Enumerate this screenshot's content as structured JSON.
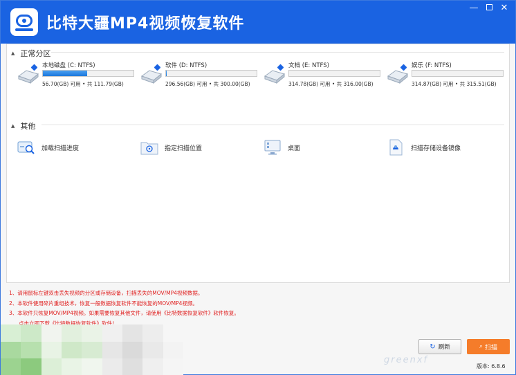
{
  "window": {
    "title": "比特大疆MP4视频恢复软件",
    "minimize": "—",
    "close": "✕"
  },
  "sections": {
    "normal_label": "正常分区",
    "other_label": "其他"
  },
  "drives": [
    {
      "name": "本地磁盘 (C: NTFS)",
      "info": "56.70(GB) 可用 • 共 111.79(GB)",
      "used_fraction": 0.49
    },
    {
      "name": "软件 (D: NTFS)",
      "info": "296.56(GB) 可用 • 共 300.00(GB)",
      "used_fraction": 0.01
    },
    {
      "name": "文档 (E: NTFS)",
      "info": "314.78(GB) 可用 • 共 316.00(GB)",
      "used_fraction": 0.0
    },
    {
      "name": "娱乐 (F: NTFS)",
      "info": "314.87(GB) 可用 • 共 315.51(GB)",
      "used_fraction": 0.0
    }
  ],
  "others": [
    {
      "label": "加载扫描进度",
      "icon": "load-scan-icon"
    },
    {
      "label": "指定扫描位置",
      "icon": "target-folder-icon"
    },
    {
      "label": "桌面",
      "icon": "desktop-icon"
    },
    {
      "label": "扫描存储设备镜像",
      "icon": "disk-image-icon"
    }
  ],
  "notes": [
    "1、请用鼠标左键双击丢失视频的分区或存储设备，扫描丢失的MOV/MP4视频数据。",
    "2、本软件使用碎片重组技术，恢复一般数据恢复软件不能恢复的MOV/MP4视频。",
    "3、本软件只恢复MOV/MP4视频。如果需要恢复其他文件，请使用《比特数据恢复软件》软件恢复。",
    "点击立即下载《比特数据恢复软件》软件！"
  ],
  "buttons": {
    "refresh": "刷新",
    "scan": "扫描"
  },
  "watermark": "greenxf",
  "version": "版本: 6.8.6",
  "colors": {
    "title_bar": "#1a63e2",
    "note_text": "#e02020",
    "scan_button": "#f57c2a",
    "bar_fill": "#1b78dc"
  }
}
